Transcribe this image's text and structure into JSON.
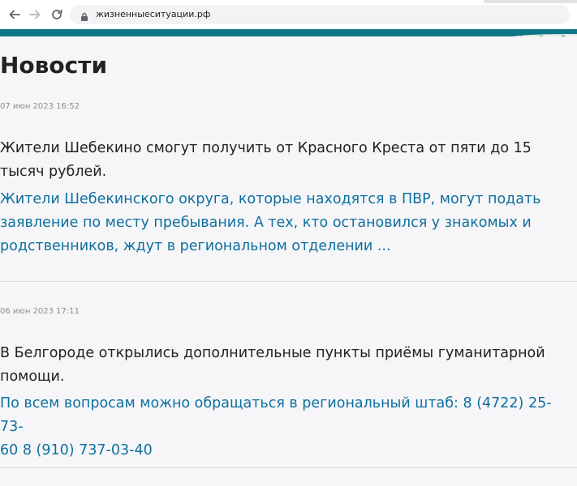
{
  "browser": {
    "url": "жизненныеситуации.рф",
    "icons": [
      "arrow-left-icon",
      "arrow-right-icon",
      "reload-icon",
      "lock-icon"
    ]
  },
  "colors": {
    "header": "#0f7686",
    "link": "#0e6f9f",
    "title": "#222222",
    "date": "#8c8c8c",
    "background": "#f6f6f8"
  },
  "page": {
    "title": "Новости"
  },
  "news": [
    {
      "date": "07 июн 2023 16:52",
      "title_lines": [
        "Жители Шебекино смогут получить от Красного Креста от пяти до 15",
        "тысяч рублей."
      ],
      "excerpt_lines": [
        "Жители Шебекинского округа, которые находятся в ПВР, могут подать",
        "заявление по месту пребывания. А тех, кто остановился у знакомых и",
        "родственников, ждут в региональном отделении ..."
      ]
    },
    {
      "date": "06 июн 2023 17:11",
      "title_lines": [
        "В Белгороде открылись дополнительные пункты приёмы гуманитарной",
        "помощи."
      ],
      "excerpt_lines": [
        "По всем вопросам можно обращаться в региональный штаб: 8 (4722) 25-73-",
        "60 8 (910) 737-03-40"
      ]
    }
  ]
}
